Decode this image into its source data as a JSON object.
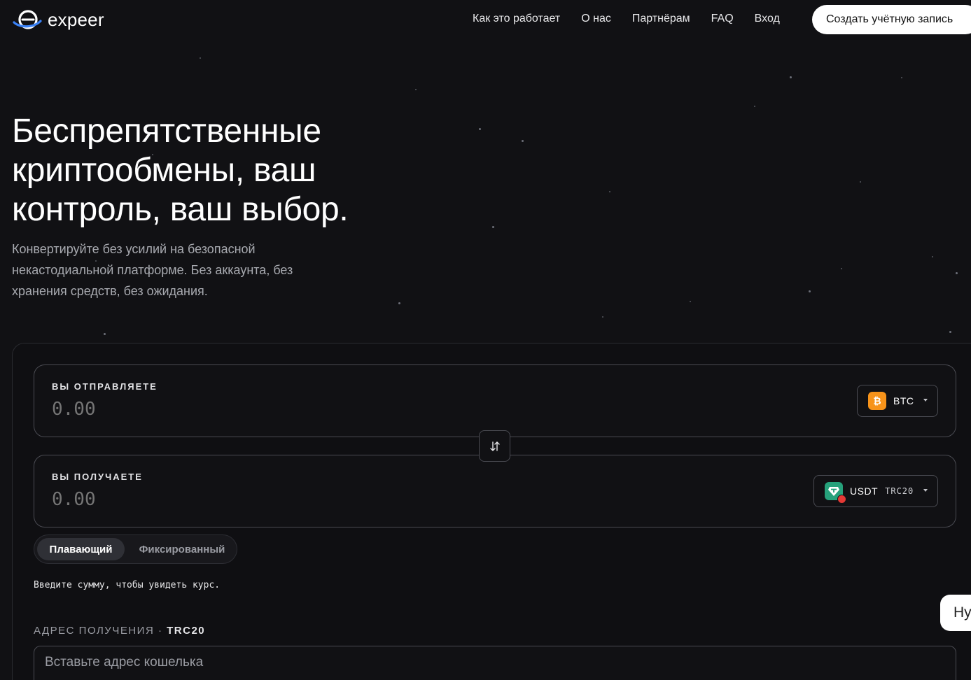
{
  "brand": {
    "name": "expeer"
  },
  "nav": {
    "items": [
      {
        "label": "Как это работает"
      },
      {
        "label": "О нас"
      },
      {
        "label": "Партнёрам"
      },
      {
        "label": "FAQ"
      },
      {
        "label": "Вход"
      }
    ],
    "cta_label": "Создать учётную запись"
  },
  "hero": {
    "title": "Беспрепятственные криптообмены, ваш контроль, ваш выбор.",
    "subtitle": "Конвертируйте без усилий на безопасной некастодиальной платформе. Без аккаунта, без хранения средств, без ожидания."
  },
  "exchange": {
    "send": {
      "label": "ВЫ ОТПРАВЛЯЕТЕ",
      "placeholder": "0.00",
      "coin": "BTC",
      "icon": "bitcoin-icon"
    },
    "receive": {
      "label": "ВЫ ПОЛУЧАЕТЕ",
      "placeholder": "0.00",
      "coin": "USDT",
      "network": "TRC20",
      "icon": "tether-icon"
    },
    "swap_icon": "swap-arrows-icon",
    "rate_modes": {
      "floating": "Плавающий",
      "fixed": "Фиксированный",
      "selected": "floating"
    },
    "hint": "Введите сумму, чтобы увидеть курс.",
    "address": {
      "label": "АДРЕС ПОЛУЧЕНИЯ",
      "separator": " · ",
      "network": "TRC20",
      "placeholder": "Вставьте адрес кошелька"
    }
  },
  "help_bubble": {
    "text": "Ну"
  },
  "colors": {
    "background": "#111114",
    "bitcoin": "#f7931a",
    "tether": "#26a17b",
    "tron": "#e53935"
  }
}
